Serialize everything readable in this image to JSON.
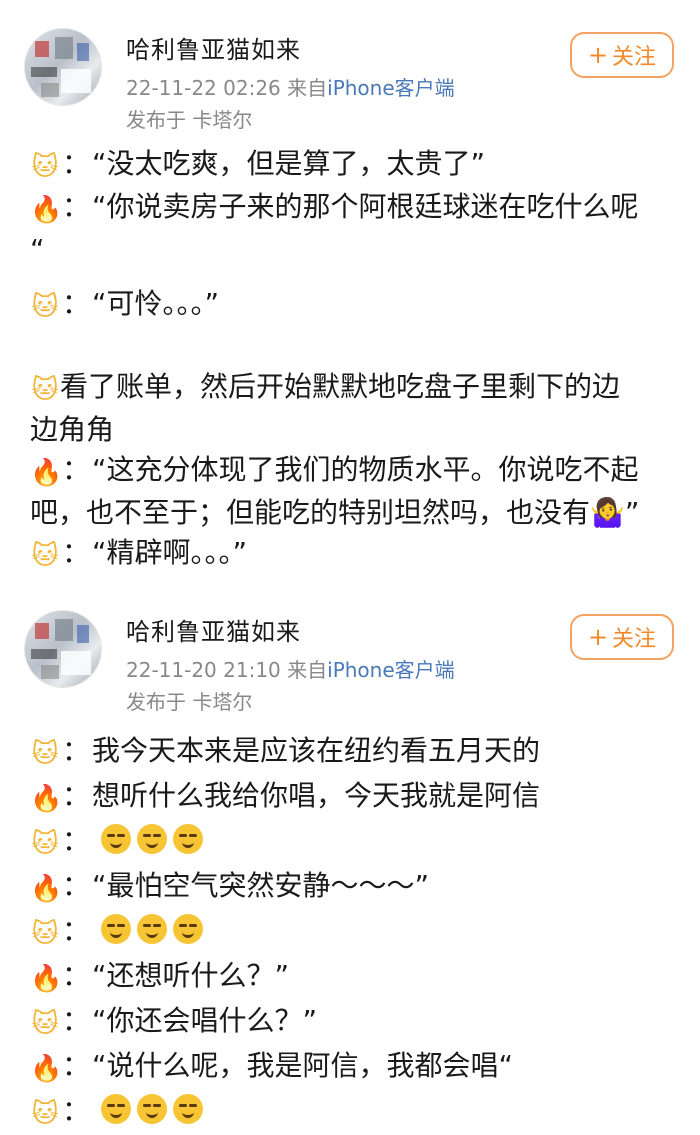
{
  "posts": [
    {
      "username": "哈利鲁亚猫如来",
      "timestamp": "22-11-22 02:26",
      "source_prefix": "来自",
      "source": "iPhone客户端",
      "location": "发布于 卡塔尔",
      "follow_label": "关注",
      "lines": [
        {
          "speaker": "cat",
          "text": "“没太吃爽，但是算了，太贵了”"
        },
        {
          "speaker": "fire",
          "text": "“你说卖房子来的那个阿根廷球迷在吃什么呢"
        },
        {
          "speaker": "none",
          "text": "“"
        },
        {
          "speaker": "cat",
          "text": "“可怜。。。”"
        },
        {
          "speaker": "cat-plain",
          "text": "看了账单，然后开始默默地吃盘子里剩下的边"
        },
        {
          "speaker": "none",
          "text": "边角角"
        },
        {
          "speaker": "fire",
          "text": "“这充分体现了我们的物质水平。你说吃不起"
        },
        {
          "speaker": "none",
          "text": "吧，也不至于；但能吃的特别坦然吗，也没有🤷‍♀️”"
        },
        {
          "speaker": "cat",
          "text": "“精辟啊。。。”"
        }
      ]
    },
    {
      "username": "哈利鲁亚猫如来",
      "timestamp": "22-11-20 21:10",
      "source_prefix": "来自",
      "source": "iPhone客户端",
      "location": "发布于 卡塔尔",
      "follow_label": "关注",
      "lines": [
        {
          "speaker": "cat",
          "text": "我今天本来是应该在纽约看五月天的"
        },
        {
          "speaker": "fire",
          "text": "想听什么我给你唱，今天我就是阿信"
        },
        {
          "speaker": "cat",
          "text": ""
        },
        {
          "speaker": "fire",
          "text": "“最怕空气突然安静～～～”"
        },
        {
          "speaker": "cat",
          "text": ""
        },
        {
          "speaker": "fire",
          "text": "“还想听什么？”"
        },
        {
          "speaker": "cat",
          "text": "“你还会唱什么？”"
        },
        {
          "speaker": "fire",
          "text": "“说什么呢，我是阿信，我都会唱“"
        },
        {
          "speaker": "cat",
          "text": ""
        }
      ]
    }
  ],
  "icons": {
    "cat": "🐱",
    "fire": "🔥",
    "colon": "：",
    "plus": "+"
  }
}
